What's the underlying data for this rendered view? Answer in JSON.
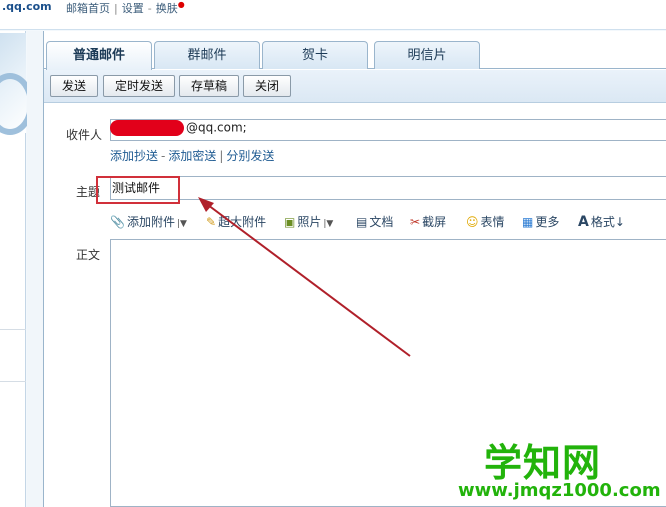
{
  "topbar": {
    "domain": ".qq.com",
    "link_home": "邮箱首页",
    "link_settings": "设置",
    "link_skin": "换肤",
    "sep": "|",
    "dash": "-"
  },
  "tabs": [
    {
      "label": "普通邮件",
      "active": true
    },
    {
      "label": "群邮件",
      "active": false
    },
    {
      "label": "贺卡",
      "active": false
    },
    {
      "label": "明信片",
      "active": false
    }
  ],
  "toolbar": {
    "send_label": "发送",
    "scheduled_label": "定时发送",
    "draft_label": "存草稿",
    "close_label": "关闭"
  },
  "compose": {
    "to_label": "收件人",
    "to_value": "@qq.com;",
    "add_cc": "添加抄送",
    "add_bcc": "添加密送",
    "separate_send": "分别发送",
    "link_dash": "-",
    "link_sep": "|",
    "subject_label": "主题",
    "subject_value": "测试邮件",
    "body_label": "正文"
  },
  "attachments": {
    "add_attachment": "添加附件",
    "large_attachment": "超大附件",
    "photo": "照片",
    "document": "文档",
    "screenshot": "截屏",
    "emoji": "表情",
    "more": "更多",
    "format": "格式↓"
  },
  "watermark": {
    "title": "学知网",
    "url": "www.jmqz1000.com"
  },
  "colors": {
    "annotation_red": "#b0202a",
    "watermark_green": "#22b30b",
    "link_blue": "#1f5b92"
  }
}
